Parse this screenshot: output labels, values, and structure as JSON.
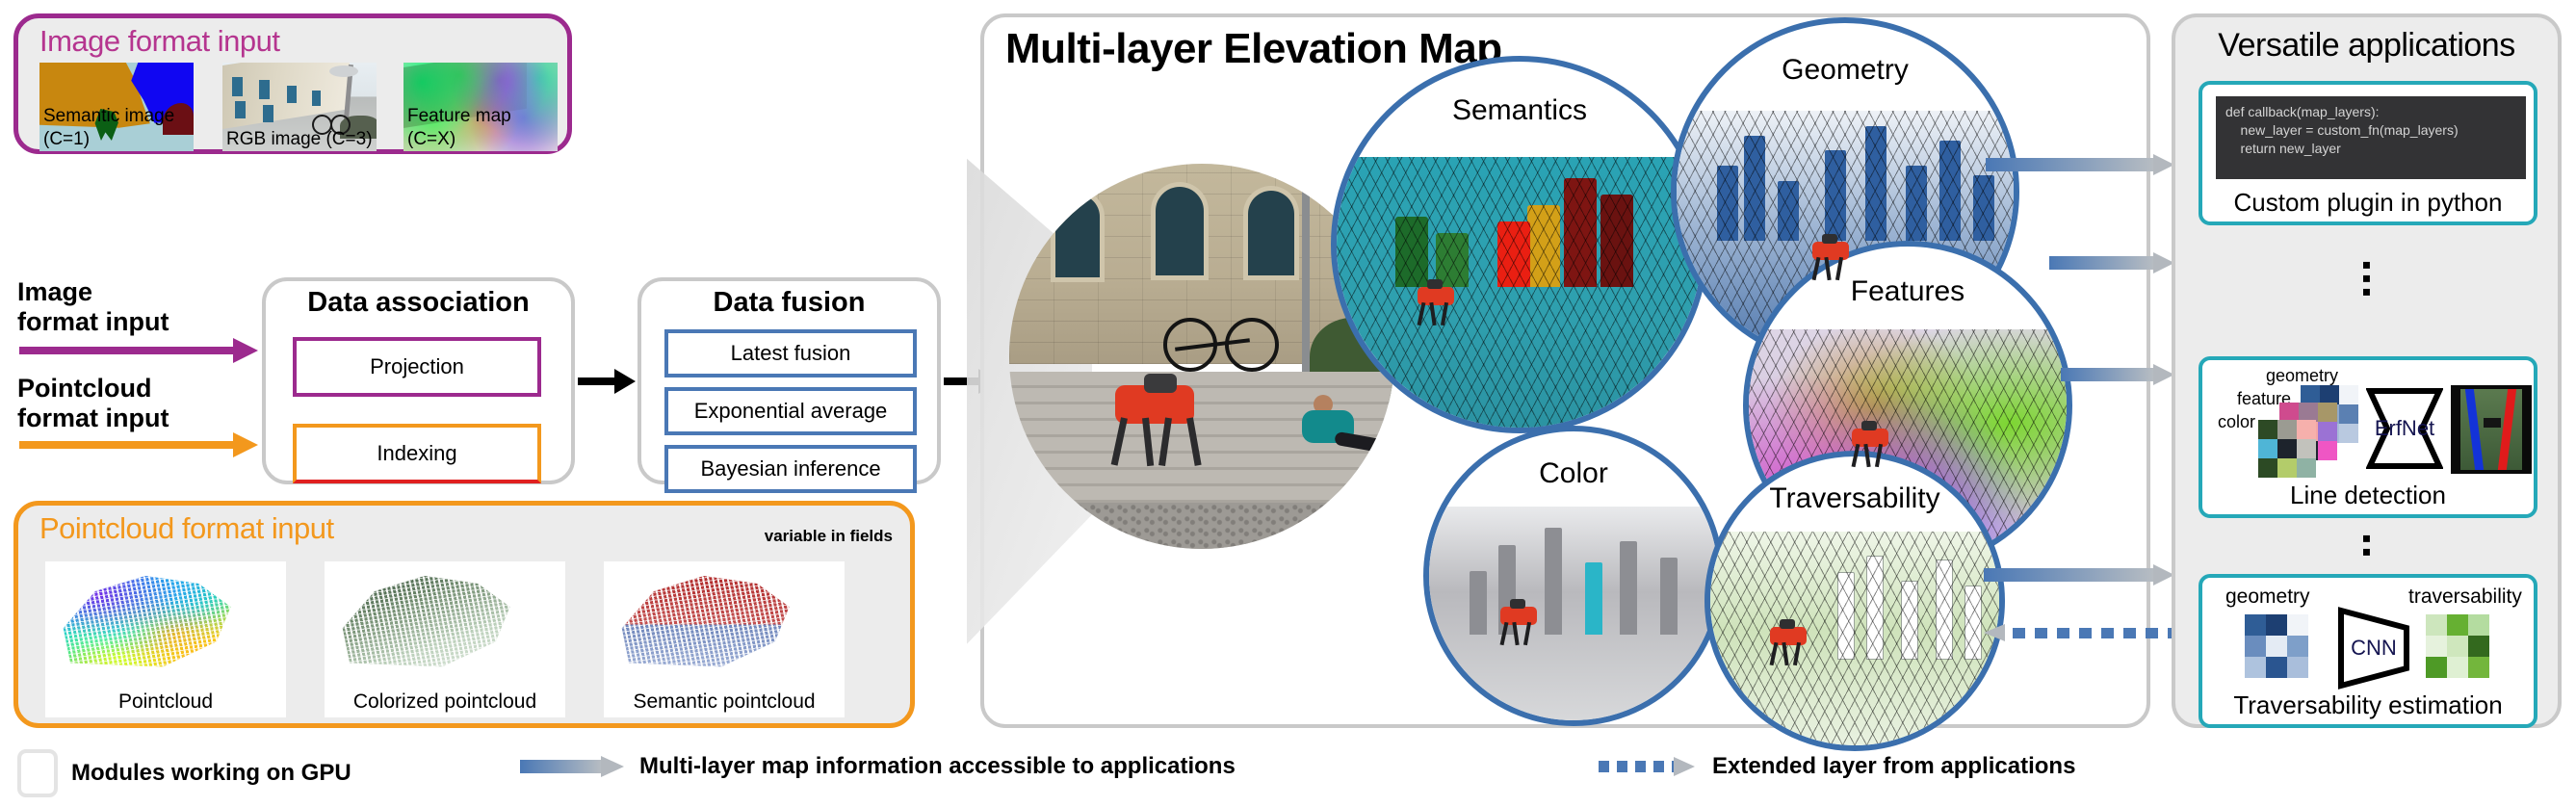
{
  "image_input": {
    "title": "Image format input",
    "accent": "#b5358f",
    "thumbs": [
      {
        "caption": "Semantic image (C=1)",
        "icon": "semantic-image-thumb"
      },
      {
        "caption": "RGB image (C=3)",
        "icon": "rgb-image-thumb"
      },
      {
        "caption": "Feature map (C=X)",
        "icon": "feature-map-thumb"
      }
    ]
  },
  "inputs": {
    "image_label": "Image\nformat input",
    "image_label_line1": "Image",
    "image_label_line2": "format input",
    "pointcloud_label_line1": "Pointcloud",
    "pointcloud_label_line2": "format input",
    "image_arrow_color": "#9c2a8e",
    "pointcloud_arrow_color": "#f3981d"
  },
  "data_association": {
    "title": "Data association",
    "items": [
      {
        "label": "Projection",
        "color": "#9c2a8e"
      },
      {
        "label": "Indexing",
        "color": "#f3981d"
      }
    ]
  },
  "data_fusion": {
    "title": "Data fusion",
    "accent": "#4a78b5",
    "items": [
      {
        "label": "Latest fusion"
      },
      {
        "label": "Exponential average"
      },
      {
        "label": "Bayesian inference"
      }
    ]
  },
  "pointcloud_input": {
    "title": "Pointcloud format input",
    "note": "variable in fields",
    "accent": "#f3981d",
    "thumbs": [
      {
        "caption": "Pointcloud",
        "icon": "pointcloud-thumb"
      },
      {
        "caption": "Colorized pointcloud",
        "icon": "colorized-pointcloud-thumb"
      },
      {
        "caption": "Semantic pointcloud",
        "icon": "semantic-pointcloud-thumb"
      }
    ]
  },
  "center": {
    "title": "Multi-layer Elevation Map",
    "bubble_border": "#3b6fad",
    "photo_alt": "robot-on-stairs-photo",
    "layers": [
      {
        "label": "Semantics"
      },
      {
        "label": "Geometry"
      },
      {
        "label": "Features"
      },
      {
        "label": "Color"
      },
      {
        "label": "Traversability"
      }
    ]
  },
  "applications": {
    "title": "Versatile applications",
    "accent": "#25a8b8",
    "plugin": {
      "caption": "Custom plugin in python",
      "code_lines": [
        "def callback(map_layers):",
        "    new_layer = custom_fn(map_layers)",
        "    return new_layer"
      ]
    },
    "line_detection": {
      "caption": "Line detection",
      "network": "ErfNet",
      "tags": [
        "geometry",
        "feature",
        "color"
      ]
    },
    "traversability": {
      "caption": "Traversability estimation",
      "network": "CNN",
      "input_tag": "geometry",
      "output_tag": "traversability"
    },
    "ellipsis": "▪"
  },
  "legend": [
    {
      "icon": "module-swatch",
      "text": "Modules working on GPU"
    },
    {
      "icon": "solid-arrow",
      "text": "Multi-layer map information accessible to applications"
    },
    {
      "icon": "dotted-arrow",
      "text": "Extended layer from applications"
    }
  ]
}
